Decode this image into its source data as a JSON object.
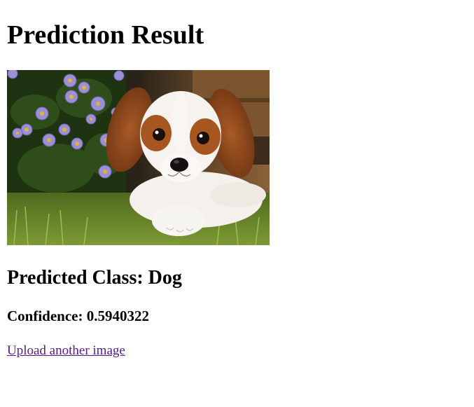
{
  "page": {
    "title": "Prediction Result"
  },
  "result": {
    "image_alt": "",
    "predicted_class_text": "Predicted Class: Dog",
    "confidence_text": "Confidence: 0.5940322"
  },
  "actions": {
    "upload_another_label": "Upload another image"
  },
  "colors": {
    "link_visited": "#551a8b",
    "text": "#000000",
    "background": "#ffffff"
  }
}
